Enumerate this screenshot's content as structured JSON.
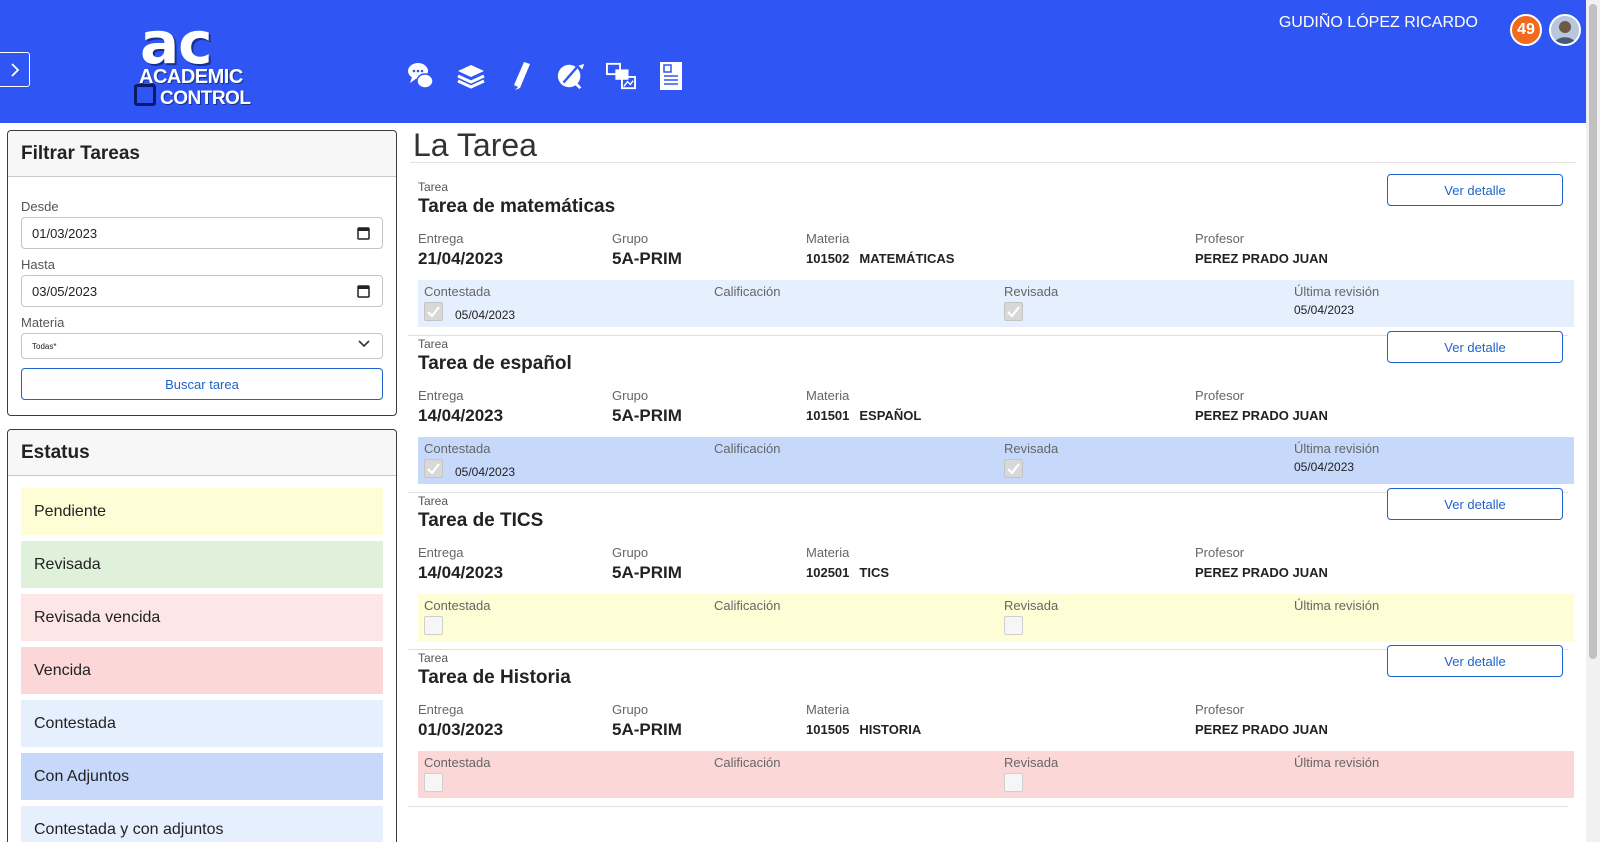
{
  "app": {
    "logo_main": "ac",
    "logo_line1": "ACADEMIC",
    "logo_line2": "CONTROL",
    "user_name": "GUDIÑO LÓPEZ RICARDO",
    "notifications": "49",
    "nav_icons": [
      "chat-icon",
      "books-icon",
      "pencil-icon",
      "rocket-icon",
      "media-icon",
      "document-icon"
    ]
  },
  "colors": {
    "header": "#2f55f5",
    "accent": "#1e63c9",
    "pendiente": "#fefdd6",
    "revisada": "#dff1db",
    "revisada_vencida": "#fde6e6",
    "vencida": "#fcd7d7",
    "contestada": "#e6effd",
    "con_adjuntos": "#c6d9fb",
    "contestada_adjuntos": "#e6effd"
  },
  "filter": {
    "title": "Filtrar Tareas",
    "desde_label": "Desde",
    "desde_value": "01/03/2023",
    "hasta_label": "Hasta",
    "hasta_value": "03/05/2023",
    "materia_label": "Materia",
    "materia_value": "Todas*",
    "search_label": "Buscar tarea"
  },
  "status": {
    "title": "Estatus",
    "items": [
      {
        "label": "Pendiente",
        "color": "#fefdd6"
      },
      {
        "label": "Revisada",
        "color": "#dff1db"
      },
      {
        "label": "Revisada vencida",
        "color": "#fde6e6"
      },
      {
        "label": "Vencida",
        "color": "#fcd7d7"
      },
      {
        "label": "Contestada",
        "color": "#e6effd"
      },
      {
        "label": "Con Adjuntos",
        "color": "#c6d9fb"
      },
      {
        "label": "Contestada y con adjuntos",
        "color": "#e6effd"
      }
    ]
  },
  "main": {
    "title": "La Tarea",
    "labels": {
      "tarea": "Tarea",
      "entrega": "Entrega",
      "grupo": "Grupo",
      "materia": "Materia",
      "profesor": "Profesor",
      "contestada": "Contestada",
      "calificacion": "Calificación",
      "revisada": "Revisada",
      "ultima_revision": "Última revisión",
      "ver_detalle": "Ver detalle"
    },
    "tasks": [
      {
        "title": "Tarea de matemáticas",
        "entrega": "21/04/2023",
        "grupo": "5A-PRIM",
        "materia_code": "101502",
        "materia_name": "MATEMÁTICAS",
        "profesor": "PEREZ PRADO JUAN",
        "contestada": true,
        "contestada_fecha": "05/04/2023",
        "revisada": true,
        "ultima_revision": "05/04/2023",
        "strip_color": "#e6effd"
      },
      {
        "title": "Tarea de español",
        "entrega": "14/04/2023",
        "grupo": "5A-PRIM",
        "materia_code": "101501",
        "materia_name": "ESPAÑOL",
        "profesor": "PEREZ PRADO JUAN",
        "contestada": true,
        "contestada_fecha": "05/04/2023",
        "revisada": true,
        "ultima_revision": "05/04/2023",
        "strip_color": "#c6d9fb"
      },
      {
        "title": "Tarea de TICS",
        "entrega": "14/04/2023",
        "grupo": "5A-PRIM",
        "materia_code": "102501",
        "materia_name": "TICS",
        "profesor": "PEREZ PRADO JUAN",
        "contestada": false,
        "contestada_fecha": "",
        "revisada": false,
        "ultima_revision": "",
        "strip_color": "#fefdd6"
      },
      {
        "title": "Tarea de Historia",
        "entrega": "01/03/2023",
        "grupo": "5A-PRIM",
        "materia_code": "101505",
        "materia_name": "HISTORIA",
        "profesor": "PEREZ PRADO JUAN",
        "contestada": false,
        "contestada_fecha": "",
        "revisada": false,
        "ultima_revision": "",
        "strip_color": "#fcd7d7"
      }
    ]
  }
}
